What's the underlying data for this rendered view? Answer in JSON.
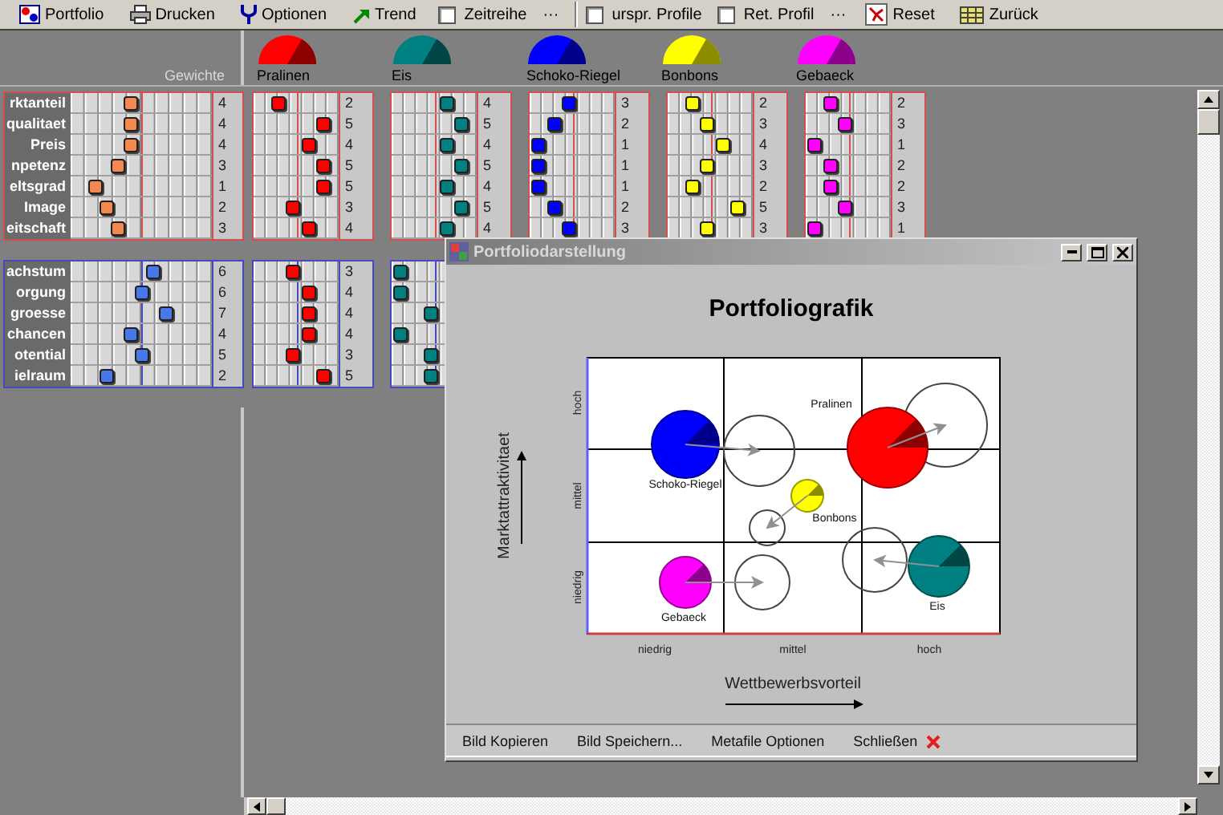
{
  "toolbar": {
    "items": [
      {
        "kind": "button",
        "label": "Portfolio"
      },
      {
        "kind": "button",
        "label": "Drucken"
      },
      {
        "kind": "button",
        "label": "Optionen"
      },
      {
        "kind": "button",
        "label": "Trend"
      },
      {
        "kind": "checkbox",
        "label": "Zeitreihe",
        "checked": false
      },
      {
        "kind": "more",
        "label": "···"
      },
      {
        "kind": "separator"
      },
      {
        "kind": "checkbox",
        "label": "urspr. Profile",
        "checked": false
      },
      {
        "kind": "checkbox",
        "label": "Ret. Profil",
        "checked": false
      },
      {
        "kind": "more",
        "label": "···"
      },
      {
        "kind": "button",
        "label": "Reset"
      },
      {
        "kind": "button",
        "label": "Zurück"
      }
    ]
  },
  "header": {
    "weights_label": "Gewichte"
  },
  "groups": [
    {
      "color": "#d05050",
      "weights": {
        "color": "#f08a50",
        "rows": [
          {
            "label": "rktanteil",
            "value": "4",
            "level": 0.42
          },
          {
            "label": "qualitaet",
            "value": "4",
            "level": 0.42
          },
          {
            "label": "Preis",
            "value": "4",
            "level": 0.42
          },
          {
            "label": "npetenz",
            "value": "3",
            "level": 0.33
          },
          {
            "label": "eltsgrad",
            "value": "1",
            "level": 0.17
          },
          {
            "label": "Image",
            "value": "2",
            "level": 0.25
          },
          {
            "label": "eitschaft",
            "value": "3",
            "level": 0.33
          }
        ]
      }
    },
    {
      "color": "#4848c0",
      "weights": {
        "color": "#4878e8",
        "rows": [
          {
            "label": "achstum",
            "value": "6",
            "level": 0.58
          },
          {
            "label": "orgung",
            "value": "6",
            "level": 0.5
          },
          {
            "label": "groesse",
            "value": "7",
            "level": 0.67
          },
          {
            "label": "chancen",
            "value": "4",
            "level": 0.42
          },
          {
            "label": "otential",
            "value": "5",
            "level": 0.5
          },
          {
            "label": "ielraum",
            "value": "2",
            "level": 0.25
          }
        ]
      }
    }
  ],
  "products": [
    {
      "name": "Pralinen",
      "color": "#ff0000",
      "ratings": [
        [
          {
            "value": "2",
            "level": 0.28
          },
          {
            "value": "5",
            "level": 0.82
          },
          {
            "value": "4",
            "level": 0.64
          },
          {
            "value": "5",
            "level": 0.82
          },
          {
            "value": "5",
            "level": 0.82
          },
          {
            "value": "3",
            "level": 0.46
          },
          {
            "value": "4",
            "level": 0.64
          }
        ],
        [
          {
            "value": "3",
            "level": 0.46
          },
          {
            "value": "4",
            "level": 0.64
          },
          {
            "value": "4",
            "level": 0.64
          },
          {
            "value": "4",
            "level": 0.64
          },
          {
            "value": "3",
            "level": 0.46
          },
          {
            "value": "5",
            "level": 0.82
          }
        ]
      ]
    },
    {
      "name": "Eis",
      "color": "#008080",
      "ratings": [
        [
          {
            "value": "4",
            "level": 0.64
          },
          {
            "value": "5",
            "level": 0.82
          },
          {
            "value": "4",
            "level": 0.64
          },
          {
            "value": "5",
            "level": 0.82
          },
          {
            "value": "4",
            "level": 0.64
          },
          {
            "value": "5",
            "level": 0.82
          },
          {
            "value": "4",
            "level": 0.64
          }
        ],
        [
          {
            "level": 0.1
          },
          {
            "level": 0.1
          },
          {
            "level": 0.46
          },
          {
            "level": 0.1
          },
          {
            "level": 0.46
          },
          {
            "level": 0.46
          }
        ]
      ]
    },
    {
      "name": "Schoko-Riegel",
      "color": "#0000ff",
      "ratings": [
        [
          {
            "value": "3",
            "level": 0.46
          },
          {
            "value": "2",
            "level": 0.28
          },
          {
            "value": "1",
            "level": 0.1
          },
          {
            "value": "1",
            "level": 0.1
          },
          {
            "value": "1",
            "level": 0.1
          },
          {
            "value": "2",
            "level": 0.28
          },
          {
            "value": "3",
            "level": 0.46
          }
        ]
      ]
    },
    {
      "name": "Bonbons",
      "color": "#ffff00",
      "ratings": [
        [
          {
            "value": "2",
            "level": 0.28
          },
          {
            "value": "3",
            "level": 0.46
          },
          {
            "value": "4",
            "level": 0.64
          },
          {
            "value": "3",
            "level": 0.46
          },
          {
            "value": "2",
            "level": 0.28
          },
          {
            "value": "5",
            "level": 0.82
          },
          {
            "value": "3",
            "level": 0.46
          }
        ]
      ]
    },
    {
      "name": "Gebaeck",
      "color": "#ff00ff",
      "ratings": [
        [
          {
            "value": "2",
            "level": 0.28
          },
          {
            "value": "3",
            "level": 0.46
          },
          {
            "value": "1",
            "level": 0.1
          },
          {
            "value": "2",
            "level": 0.28
          },
          {
            "value": "2",
            "level": 0.28
          },
          {
            "value": "3",
            "level": 0.46
          },
          {
            "value": "1",
            "level": 0.1
          }
        ]
      ]
    }
  ],
  "dialog": {
    "title": "Portfoliodarstellung",
    "chart": {
      "title": "Portfoliografik",
      "ylabel": "Marktattraktivitaet",
      "xlabel": "Wettbewerbsvorteil",
      "yticks": [
        "hoch",
        "mittel",
        "niedrig"
      ],
      "xticks": [
        "niedrig",
        "mittel",
        "hoch"
      ],
      "bubbles": [
        {
          "label": "Pralinen"
        },
        {
          "label": "Eis"
        },
        {
          "label": "Schoko-Riegel"
        },
        {
          "label": "Bonbons"
        },
        {
          "label": "Gebaeck"
        }
      ]
    },
    "buttons": [
      {
        "kind": "text",
        "label": "Bild Kopieren"
      },
      {
        "kind": "text",
        "label": "Bild Speichern..."
      },
      {
        "kind": "text",
        "label": "Metafile Optionen"
      },
      {
        "kind": "close",
        "label": "Schließen"
      }
    ]
  }
}
